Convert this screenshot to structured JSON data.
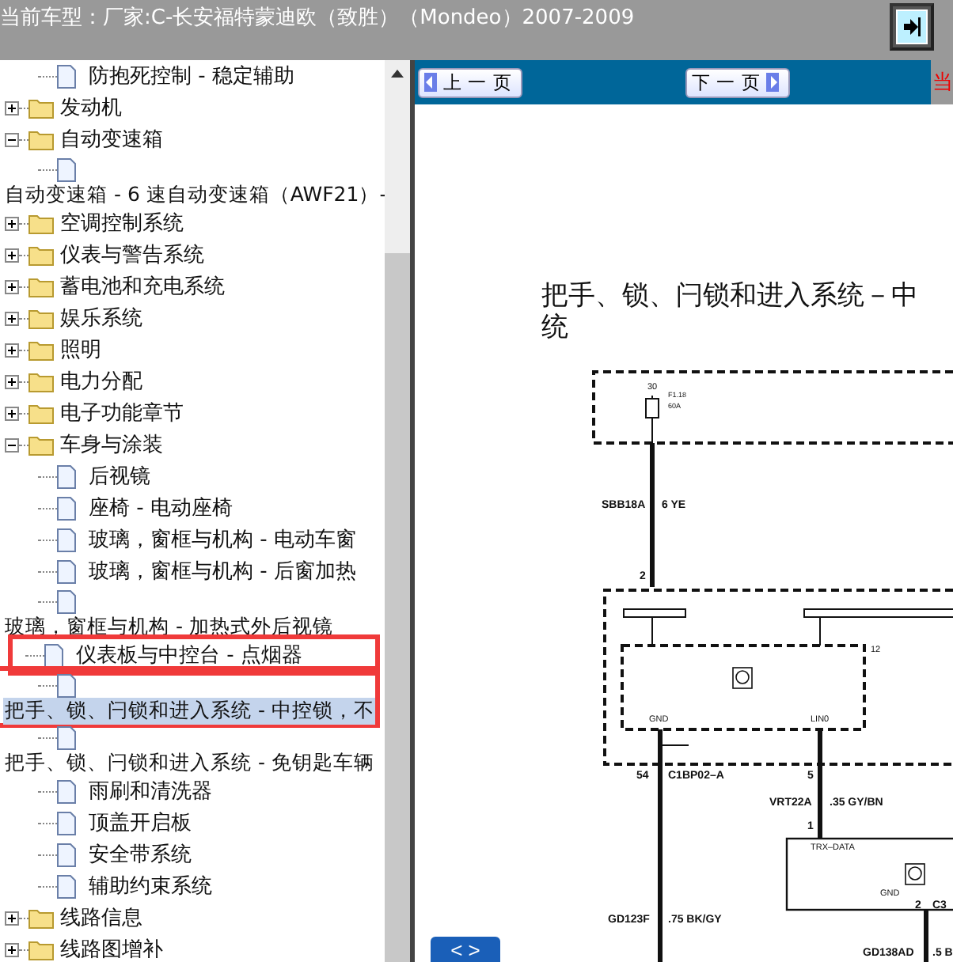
{
  "header": {
    "label": "当前车型：",
    "model": "厂家:C-长安福特蒙迪欧（致胜）（Mondeo）2007-2009"
  },
  "tree": [
    {
      "kind": "doc",
      "label": "防抱死控制 - 稳定辅助",
      "wrapped": false,
      "selected": false,
      "annotated": false
    },
    {
      "kind": "folder",
      "label": "发动机",
      "expanded": false
    },
    {
      "kind": "folder",
      "label": "自动变速箱",
      "expanded": true,
      "children": [
        {
          "kind": "doc",
          "label": "自动变速箱 - 6 速自动变速箱（AWF21）-",
          "wrapped": true,
          "selected": false,
          "annotated": false
        }
      ]
    },
    {
      "kind": "folder",
      "label": "空调控制系统",
      "expanded": false
    },
    {
      "kind": "folder",
      "label": "仪表与警告系统",
      "expanded": false
    },
    {
      "kind": "folder",
      "label": "蓄电池和充电系统",
      "expanded": false
    },
    {
      "kind": "folder",
      "label": "娱乐系统",
      "expanded": false
    },
    {
      "kind": "folder",
      "label": "照明",
      "expanded": false
    },
    {
      "kind": "folder",
      "label": "电力分配",
      "expanded": false
    },
    {
      "kind": "folder",
      "label": "电子功能章节",
      "expanded": false
    },
    {
      "kind": "folder",
      "label": "车身与涂装",
      "expanded": true,
      "children": [
        {
          "kind": "doc",
          "label": "后视镜",
          "wrapped": false,
          "selected": false,
          "annotated": false
        },
        {
          "kind": "doc",
          "label": "座椅 - 电动座椅",
          "wrapped": false,
          "selected": false,
          "annotated": false
        },
        {
          "kind": "doc",
          "label": "玻璃，窗框与机构 - 电动车窗",
          "wrapped": false,
          "selected": false,
          "annotated": false
        },
        {
          "kind": "doc",
          "label": "玻璃，窗框与机构 - 后窗加热",
          "wrapped": false,
          "selected": false,
          "annotated": false
        },
        {
          "kind": "doc",
          "label": "玻璃，窗框与机构 - 加热式外后视镜",
          "wrapped": true,
          "selected": false,
          "annotated": false
        },
        {
          "kind": "doc",
          "label": "仪表板与中控台 - 点烟器",
          "wrapped": false,
          "selected": false,
          "annotated": true
        },
        {
          "kind": "doc",
          "label": "把手、锁、闩锁和进入系统 - 中控锁，不",
          "wrapped": true,
          "selected": true,
          "annotated": true
        },
        {
          "kind": "doc",
          "label": "把手、锁、闩锁和进入系统 - 免钥匙车辆",
          "wrapped": true,
          "selected": false,
          "annotated": false
        },
        {
          "kind": "doc",
          "label": "雨刷和清洗器",
          "wrapped": false,
          "selected": false,
          "annotated": false
        },
        {
          "kind": "doc",
          "label": "顶盖开启板",
          "wrapped": false,
          "selected": false,
          "annotated": false
        },
        {
          "kind": "doc",
          "label": "安全带系统",
          "wrapped": false,
          "selected": false,
          "annotated": false
        },
        {
          "kind": "doc",
          "label": "辅助约束系统",
          "wrapped": false,
          "selected": false,
          "annotated": false
        }
      ]
    },
    {
      "kind": "folder",
      "label": "线路信息",
      "expanded": false
    },
    {
      "kind": "folder",
      "label": "线路图增补",
      "expanded": false
    }
  ],
  "viewer": {
    "prev_button": "上 一 页",
    "next_button": "下 一 页",
    "side_label": "当",
    "title_lines": [
      "把手、锁、闩锁和进入系统－中",
      "统"
    ],
    "diagram_labels": [
      "30",
      "F1.18",
      "60A",
      "SBB18A",
      "6 YE",
      "2",
      "12",
      "GND",
      "LIN0",
      "54",
      "C1BP02–A",
      "5",
      "VRT22A",
      ".35 GY/BN",
      "1",
      "TRX–DATA",
      "GND",
      "2",
      "C3",
      "GD123F",
      ".75 BK/GY",
      "GD138AD",
      ".5 B"
    ],
    "toggle_button": "< >"
  }
}
